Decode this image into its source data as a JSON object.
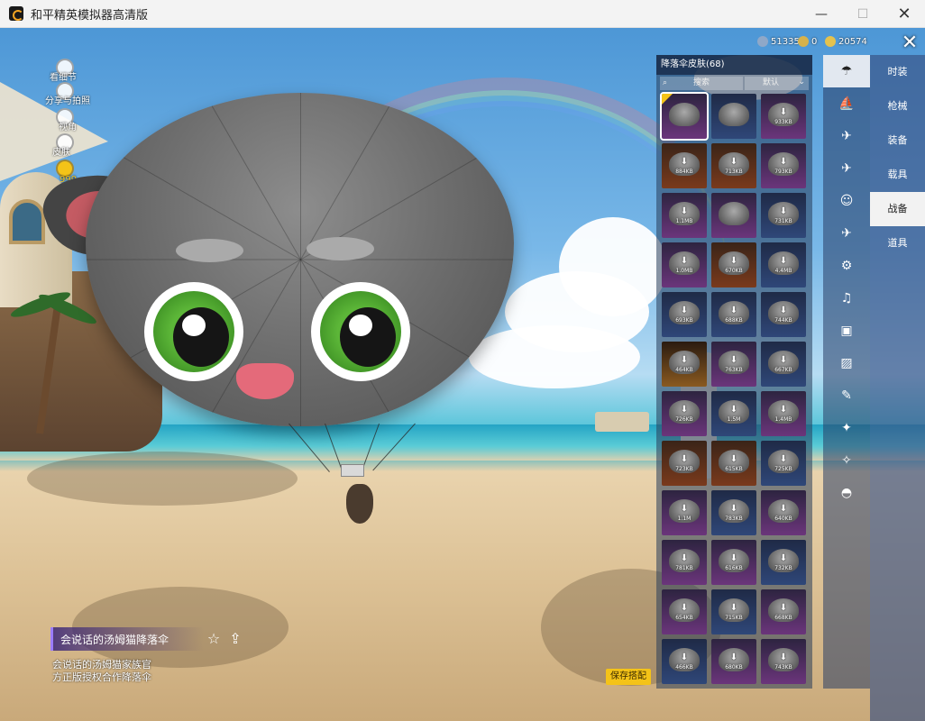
{
  "window": {
    "title": "和平精英模拟器高清版",
    "min_glyph": "—",
    "max_glyph": "☐",
    "close_glyph": "✕"
  },
  "left_quick": [
    {
      "label": "看细节"
    },
    {
      "label": "分享与拍照"
    },
    {
      "label": "视角"
    },
    {
      "label": "皮肤"
    },
    {
      "label": "999"
    }
  ],
  "item": {
    "name": "会说话的汤姆猫降落伞",
    "desc_line1": "会说话的汤姆猫家族官",
    "desc_line2": "方正版授权合作降落伞",
    "star_glyph": "☆",
    "share_glyph": "⇪"
  },
  "save_button": {
    "label": "保存搭配"
  },
  "currency": [
    {
      "value": "51335",
      "color": "#8fa8c8"
    },
    {
      "value": "0",
      "color": "#d8b24a"
    },
    {
      "value": "20574",
      "color": "#e4c24e"
    }
  ],
  "close_glyph": "✕",
  "panel": {
    "header": "降落伞皮肤(68)",
    "search_placeholder": "搜索",
    "search_icon_glyph": "⌕",
    "sort_value": "默认",
    "sort_chevron": "⌄",
    "download_glyph": "⬇",
    "tiles": [
      {
        "size": "",
        "style": "purple",
        "dl": false,
        "selected": true
      },
      {
        "size": "",
        "style": "blue",
        "dl": false,
        "selected": false
      },
      {
        "size": "933KB",
        "style": "purple",
        "dl": true,
        "selected": false
      },
      {
        "size": "884KB",
        "style": "orange",
        "dl": true,
        "selected": false
      },
      {
        "size": "713KB",
        "style": "orange",
        "dl": true,
        "selected": false
      },
      {
        "size": "793KB",
        "style": "purple",
        "dl": true,
        "selected": false
      },
      {
        "size": "1.1MB",
        "style": "purple",
        "dl": true,
        "selected": false
      },
      {
        "size": "",
        "style": "purple",
        "dl": false,
        "selected": false
      },
      {
        "size": "731KB",
        "style": "blue",
        "dl": true,
        "selected": false
      },
      {
        "size": "1.0MB",
        "style": "purple",
        "dl": true,
        "selected": false
      },
      {
        "size": "670KB",
        "style": "orange",
        "dl": true,
        "selected": false
      },
      {
        "size": "4.4MB",
        "style": "blue",
        "dl": true,
        "selected": false
      },
      {
        "size": "693KB",
        "style": "blue",
        "dl": true,
        "selected": false
      },
      {
        "size": "688KB",
        "style": "blue",
        "dl": true,
        "selected": false
      },
      {
        "size": "744KB",
        "style": "blue",
        "dl": true,
        "selected": false
      },
      {
        "size": "464KB",
        "style": "gold",
        "dl": true,
        "selected": false
      },
      {
        "size": "763KB",
        "style": "purple",
        "dl": true,
        "selected": false
      },
      {
        "size": "667KB",
        "style": "blue",
        "dl": true,
        "selected": false
      },
      {
        "size": "726KB",
        "style": "purple",
        "dl": true,
        "selected": false
      },
      {
        "size": "1.5M",
        "style": "blue",
        "dl": true,
        "selected": false
      },
      {
        "size": "1.4MB",
        "style": "purple",
        "dl": true,
        "selected": false
      },
      {
        "size": "723KB",
        "style": "orange",
        "dl": true,
        "selected": false
      },
      {
        "size": "615KB",
        "style": "orange",
        "dl": true,
        "selected": false
      },
      {
        "size": "725KB",
        "style": "blue",
        "dl": true,
        "selected": false
      },
      {
        "size": "1.1M",
        "style": "purple",
        "dl": true,
        "selected": false
      },
      {
        "size": "783KB",
        "style": "blue",
        "dl": true,
        "selected": false
      },
      {
        "size": "640KB",
        "style": "purple",
        "dl": true,
        "selected": false
      },
      {
        "size": "781KB",
        "style": "purple",
        "dl": true,
        "selected": false
      },
      {
        "size": "616KB",
        "style": "purple",
        "dl": true,
        "selected": false
      },
      {
        "size": "732KB",
        "style": "blue",
        "dl": true,
        "selected": false
      },
      {
        "size": "654KB",
        "style": "purple",
        "dl": true,
        "selected": false
      },
      {
        "size": "715KB",
        "style": "blue",
        "dl": true,
        "selected": false
      },
      {
        "size": "668KB",
        "style": "purple",
        "dl": true,
        "selected": false
      },
      {
        "size": "466KB",
        "style": "blue",
        "dl": true,
        "selected": false
      },
      {
        "size": "680KB",
        "style": "purple",
        "dl": true,
        "selected": false
      },
      {
        "size": "743KB",
        "style": "purple",
        "dl": true,
        "selected": false
      }
    ]
  },
  "icon_column": [
    {
      "name": "parachute-icon",
      "glyph": "☂",
      "active": true
    },
    {
      "name": "glider-icon",
      "glyph": "⛵",
      "active": false
    },
    {
      "name": "plane-icon",
      "glyph": "✈",
      "active": false
    },
    {
      "name": "jet-icon",
      "glyph": "✈",
      "active": false
    },
    {
      "name": "emote-icon",
      "glyph": "☺",
      "active": false
    },
    {
      "name": "drone-icon",
      "glyph": "✈",
      "active": false
    },
    {
      "name": "backpack-icon",
      "glyph": "⚙",
      "active": false
    },
    {
      "name": "sound-icon",
      "glyph": "♫",
      "active": false
    },
    {
      "name": "card-icon",
      "glyph": "▣",
      "active": false
    },
    {
      "name": "picture-icon",
      "glyph": "▨",
      "active": false
    },
    {
      "name": "spray-icon",
      "glyph": "✎",
      "active": false
    },
    {
      "name": "sparkle-icon",
      "glyph": "✦",
      "active": false
    },
    {
      "name": "wand-icon",
      "glyph": "✧",
      "active": false
    },
    {
      "name": "helmet-icon",
      "glyph": "◓",
      "active": false
    }
  ],
  "categories": [
    {
      "label": "时装",
      "active": false
    },
    {
      "label": "枪械",
      "active": false
    },
    {
      "label": "装备",
      "active": false
    },
    {
      "label": "载具",
      "active": false
    },
    {
      "label": "战备",
      "active": true
    },
    {
      "label": "道具",
      "active": false
    }
  ]
}
